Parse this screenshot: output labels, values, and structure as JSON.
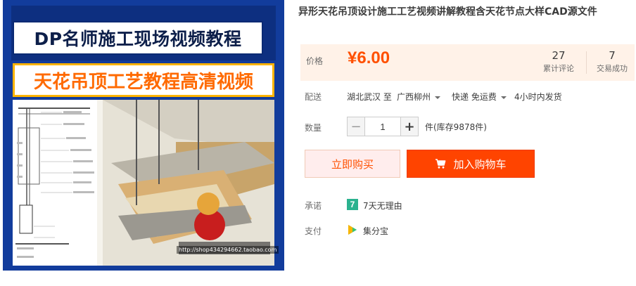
{
  "promo": {
    "title": "DP名师施工现场视频教程",
    "subtitle": "天花吊顶工艺教程高清视频",
    "watermark": "http://shop434294662.taobao.com"
  },
  "product": {
    "title": "异形天花吊顶设计施工工艺视频讲解教程含天花节点大样CAD源文件"
  },
  "price": {
    "label": "价格",
    "value": "¥6.00",
    "reviews_count": "27",
    "reviews_label": "累计评论",
    "deals_count": "7",
    "deals_label": "交易成功"
  },
  "shipping": {
    "label": "配送",
    "from": "湖北武汉 至",
    "to": "广西柳州",
    "method": "快递 免运费",
    "time": "4小时内发货"
  },
  "quantity": {
    "label": "数量",
    "minus": "−",
    "value": "1",
    "plus": "+",
    "stock": "件(库存9878件)"
  },
  "actions": {
    "buy_now": "立即购买",
    "add_to_cart": "加入购物车"
  },
  "promise": {
    "label": "承诺",
    "icon_text": "7",
    "text": "7天无理由"
  },
  "payment": {
    "label": "支付",
    "text": "集分宝"
  },
  "colors": {
    "accent": "#ff5000",
    "cart_button": "#ff4400",
    "price_bg": "#fff2e8",
    "promo_bg": "#123c9c"
  },
  "icons": [
    "cart-icon",
    "promise-7day-icon",
    "jifenbao-icon",
    "caret-down-icon"
  ]
}
